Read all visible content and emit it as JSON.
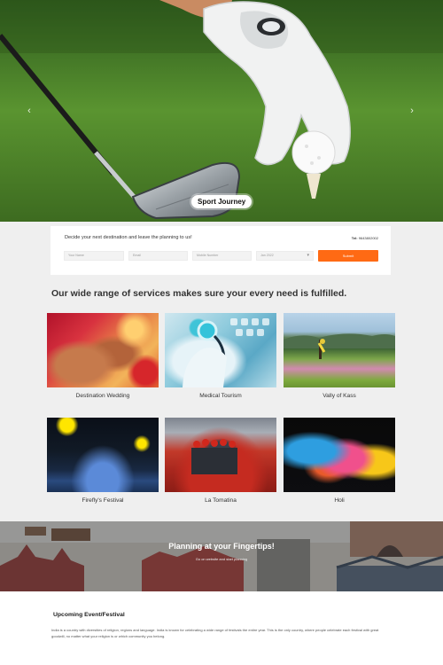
{
  "hero": {
    "badge": "Sport Journey",
    "prev_icon": "chevron-left-icon",
    "next_icon": "chevron-right-icon",
    "prev_glyph": "‹",
    "next_glyph": "›"
  },
  "planner": {
    "title": "Decide your next destination and leave the planning to us!",
    "phone_label": "Tel:",
    "phone": "9643802002",
    "fields": {
      "name_placeholder": "Your Name",
      "email_placeholder": "Email",
      "mobile_placeholder": "Mobile Number",
      "month_value": "Jan 2022"
    },
    "submit_label": "Submit"
  },
  "services": {
    "title": "Our wide range of services makes sure your every need is fulfilled.",
    "cards": [
      {
        "label": "Destination Wedding"
      },
      {
        "label": "Medical Tourism"
      },
      {
        "label": "Vally of Kass"
      },
      {
        "label": "Firefly's Festival"
      },
      {
        "label": "La Tomatina"
      },
      {
        "label": "Holi"
      }
    ]
  },
  "banner": {
    "title": "Planning at your Fingertips!",
    "subtitle": "Go on website and start planning"
  },
  "events": {
    "title": "Upcoming Event/Festival",
    "description": "India is a country with diversities of religion, regions and language. India is known for celebrating a wide range of festivals the entire year. This is the only country, where people celebrate each festival with great goodwill, no matter what your religion is or which community you belong."
  },
  "colors": {
    "accent": "#ff6a14",
    "section_grey": "#efefef"
  }
}
